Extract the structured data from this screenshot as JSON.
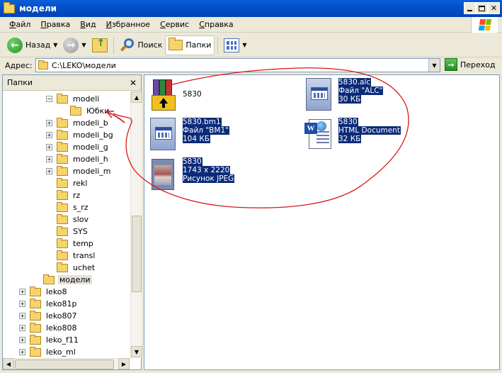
{
  "window": {
    "title": "модели"
  },
  "menu": [
    {
      "label": "Файл",
      "u": "Ф",
      "rest": "айл"
    },
    {
      "label": "Правка",
      "u": "П",
      "rest": "равка"
    },
    {
      "label": "Вид",
      "u": "В",
      "rest": "ид"
    },
    {
      "label": "Избранное",
      "u": "И",
      "rest": "збранное"
    },
    {
      "label": "Сервис",
      "u": "С",
      "rest": "ервис"
    },
    {
      "label": "Справка",
      "u": "С",
      "rest": "правка"
    }
  ],
  "toolbar": {
    "back_label": "Назад",
    "search_label": "Поиск",
    "folders_label": "Папки"
  },
  "address": {
    "label": "Адрес:",
    "value": "C:\\LEKO\\модели",
    "go_label": "Переход"
  },
  "pane": {
    "title": "Папки"
  },
  "tree": [
    {
      "label": "modeli",
      "level": 3,
      "exp": "−"
    },
    {
      "label": "Юбки",
      "level": 4,
      "exp": ""
    },
    {
      "label": "modeli_b",
      "level": 3,
      "exp": "+"
    },
    {
      "label": "modeli_bg",
      "level": 3,
      "exp": "+"
    },
    {
      "label": "modeli_g",
      "level": 3,
      "exp": "+"
    },
    {
      "label": "modeli_h",
      "level": 3,
      "exp": "+"
    },
    {
      "label": "modeli_m",
      "level": 3,
      "exp": "+"
    },
    {
      "label": "rekl",
      "level": 3,
      "exp": ""
    },
    {
      "label": "rz",
      "level": 3,
      "exp": ""
    },
    {
      "label": "s_rz",
      "level": 3,
      "exp": ""
    },
    {
      "label": "slov",
      "level": 3,
      "exp": ""
    },
    {
      "label": "SYS",
      "level": 3,
      "exp": ""
    },
    {
      "label": "temp",
      "level": 3,
      "exp": ""
    },
    {
      "label": "transl",
      "level": 3,
      "exp": ""
    },
    {
      "label": "uchet",
      "level": 3,
      "exp": ""
    },
    {
      "label": "модели",
      "level": 2,
      "exp": "",
      "selected": true
    },
    {
      "label": "leko8",
      "level": 1,
      "exp": "+"
    },
    {
      "label": "leko81p",
      "level": 1,
      "exp": "+"
    },
    {
      "label": "leko807",
      "level": 1,
      "exp": "+"
    },
    {
      "label": "leko808",
      "level": 1,
      "exp": "+"
    },
    {
      "label": "leko_f11",
      "level": 1,
      "exp": "+"
    },
    {
      "label": "leko_ml",
      "level": 1,
      "exp": "+"
    }
  ],
  "files": [
    {
      "id": "rar",
      "lines": [
        "5830"
      ],
      "selected": false,
      "icon": "winrar-archive-icon"
    },
    {
      "id": "alc",
      "lines": [
        "5830.alc",
        "Файл \"ALC\"",
        "30 КБ"
      ],
      "selected": true,
      "icon": "alc-file-icon"
    },
    {
      "id": "bm1",
      "lines": [
        "5830.bm1",
        "Файл \"BM1\"",
        "104 КБ"
      ],
      "selected": true,
      "icon": "bm1-file-icon"
    },
    {
      "id": "html",
      "lines": [
        "5830",
        "HTML Document",
        "32 КБ"
      ],
      "selected": true,
      "icon": "word-html-document-icon"
    },
    {
      "id": "jpg",
      "lines": [
        "5830",
        "1743 x 2220",
        "Рисунок JPEG"
      ],
      "selected": true,
      "icon": "jpeg-image-icon"
    }
  ],
  "colors": {
    "titlebar": "#0350c8",
    "selection": "#0b2b7a",
    "annotation": "#d81818"
  }
}
